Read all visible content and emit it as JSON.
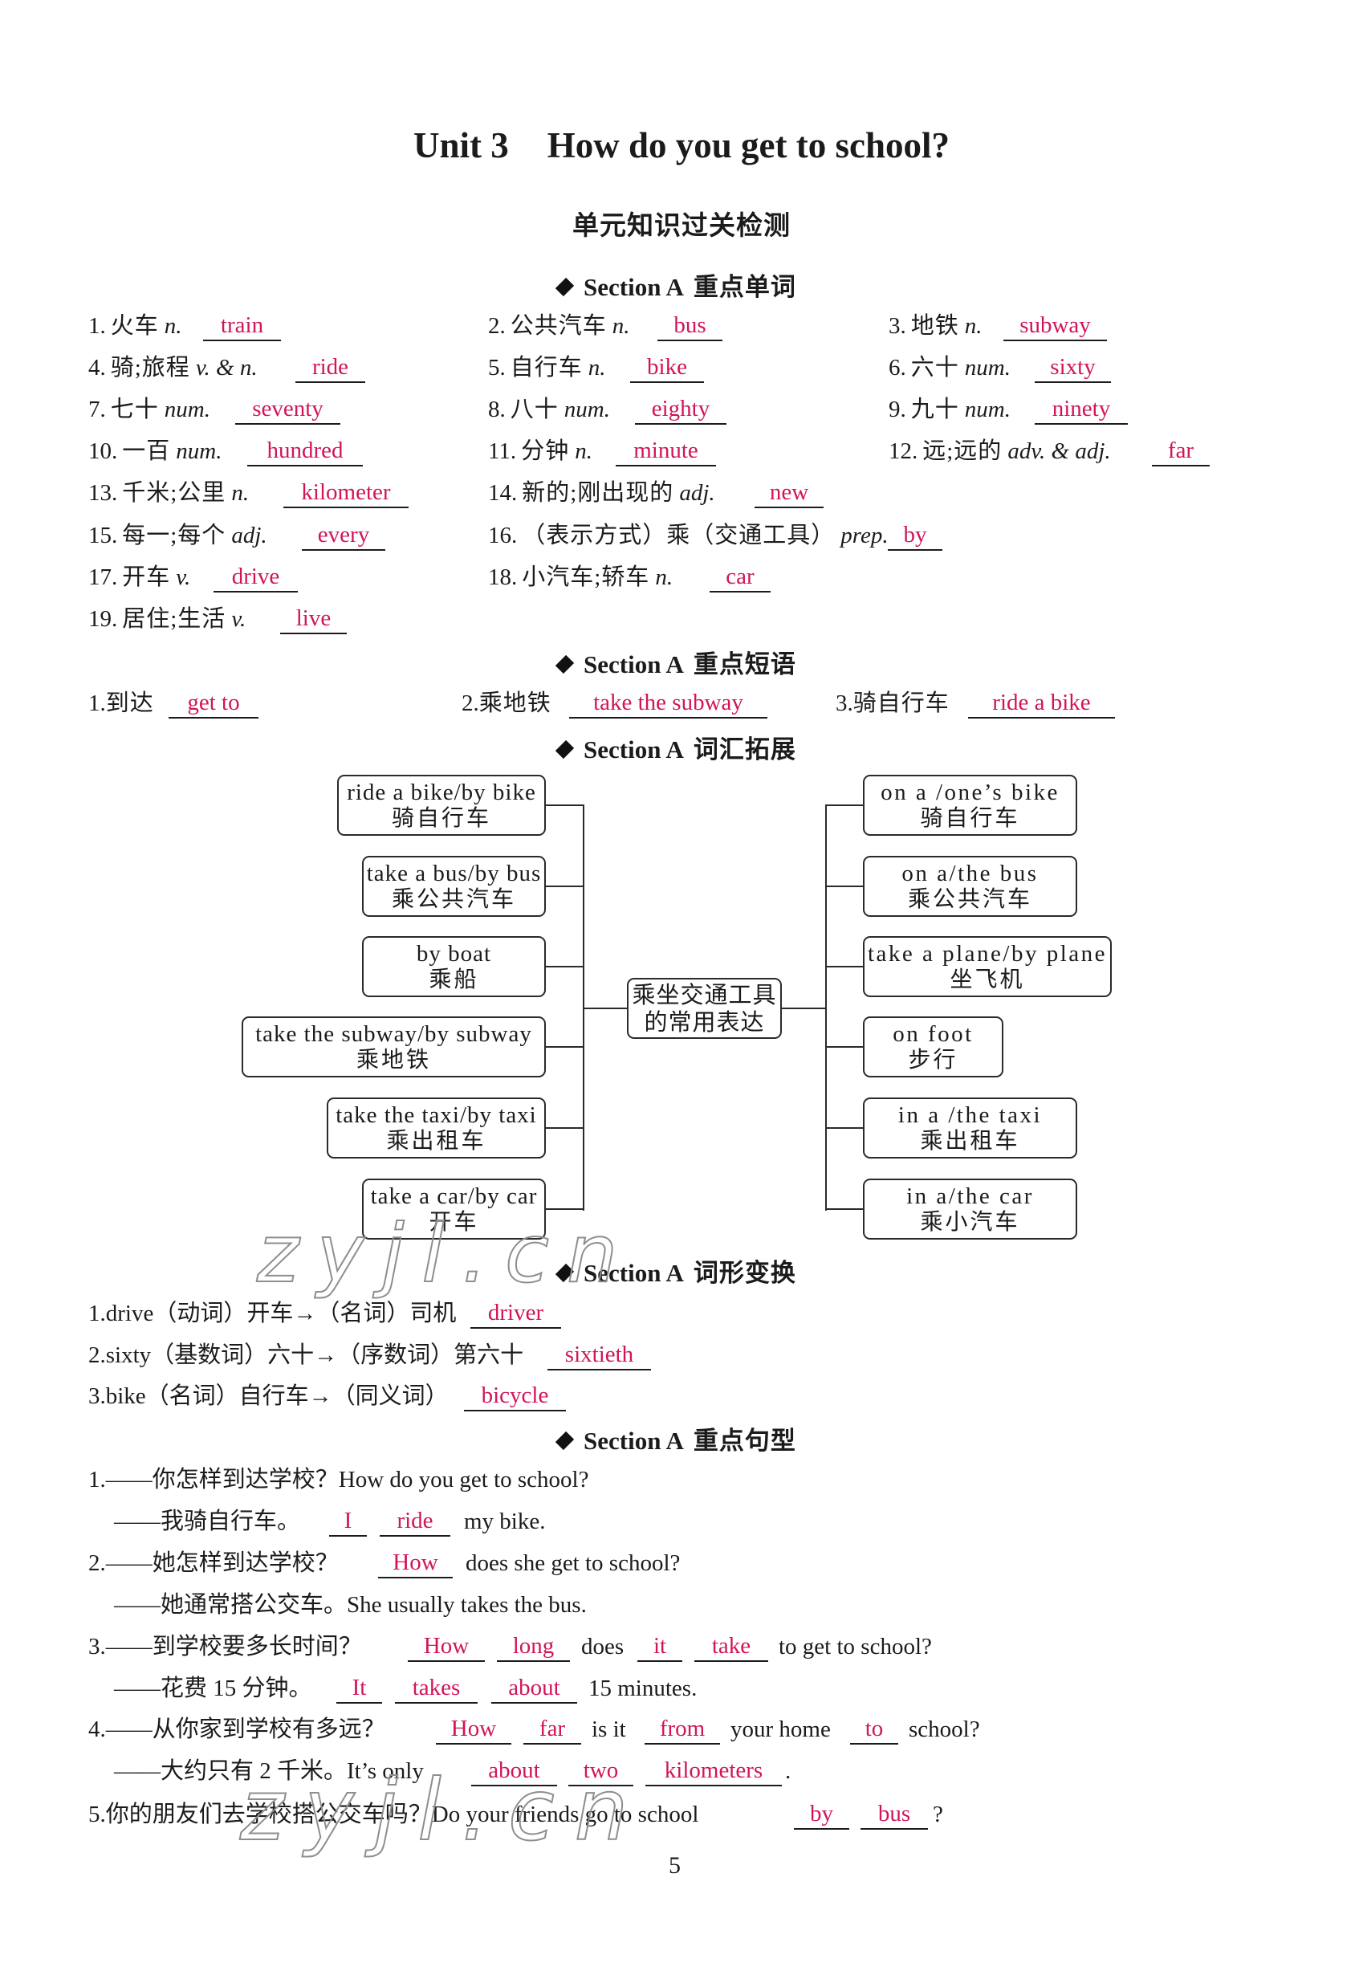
{
  "title": {
    "unit": "Unit 3",
    "text": "How do you get to school?"
  },
  "subtitle": "单元知识过关检测",
  "colors": {
    "answer": "#d2145a",
    "text": "#1b1b1b",
    "watermark_outline": "#8e8e8e"
  },
  "sections": {
    "vocabulary": {
      "icon": "diamond-bullet",
      "en": "Section A",
      "cn": "重点单词"
    },
    "phrases": {
      "icon": "diamond-bullet",
      "en": "Section A",
      "cn": "重点短语"
    },
    "expansion": {
      "icon": "diamond-bullet",
      "en": "Section A",
      "cn": "词汇拓展"
    },
    "word_forms": {
      "icon": "diamond-bullet",
      "en": "Section A",
      "cn": "词形变换"
    },
    "sentences": {
      "icon": "diamond-bullet",
      "en": "Section A",
      "cn": "重点句型"
    }
  },
  "vocabulary": [
    {
      "number": "1.",
      "chinese": "火车",
      "pos": "n.",
      "answer": "train"
    },
    {
      "number": "2.",
      "chinese": "公共汽车",
      "pos": "n.",
      "answer": "bus"
    },
    {
      "number": "3.",
      "chinese": "地铁",
      "pos": "n.",
      "answer": "subway"
    },
    {
      "number": "4.",
      "chinese": "骑;旅程",
      "pos": "v. & n.",
      "answer": "ride"
    },
    {
      "number": "5.",
      "chinese": "自行车",
      "pos": "n.",
      "answer": "bike"
    },
    {
      "number": "6.",
      "chinese": "六十",
      "pos": "num.",
      "answer": "sixty"
    },
    {
      "number": "7.",
      "chinese": "七十",
      "pos": "num.",
      "answer": "seventy"
    },
    {
      "number": "8.",
      "chinese": "八十",
      "pos": "num.",
      "answer": "eighty"
    },
    {
      "number": "9.",
      "chinese": "九十",
      "pos": "num.",
      "answer": "ninety"
    },
    {
      "number": "10.",
      "chinese": "一百",
      "pos": "num.",
      "answer": "hundred"
    },
    {
      "number": "11.",
      "chinese": "分钟",
      "pos": "n.",
      "answer": "minute"
    },
    {
      "number": "12.",
      "chinese": "远;远的",
      "pos": "adv. & adj.",
      "answer": "far"
    },
    {
      "number": "13.",
      "chinese": "千米;公里",
      "pos": "n.",
      "answer": "kilometer"
    },
    {
      "number": "14.",
      "chinese": "新的;刚出现的",
      "pos": "adj.",
      "answer": "new"
    },
    {
      "number": "15.",
      "chinese": "每一;每个",
      "pos": "adj.",
      "answer": "every"
    },
    {
      "number": "16.",
      "chinese": "（表示方式）乘（交通工具）",
      "pos": "prep.",
      "answer": "by"
    },
    {
      "number": "17.",
      "chinese": "开车",
      "pos": "v.",
      "answer": "drive"
    },
    {
      "number": "18.",
      "chinese": "小汽车;轿车",
      "pos": "n.",
      "answer": "car"
    },
    {
      "number": "19.",
      "chinese": "居住;生活",
      "pos": "v.",
      "answer": "live"
    }
  ],
  "phrases": [
    {
      "number": "1.",
      "chinese": "到达",
      "answer": "get to"
    },
    {
      "number": "2.",
      "chinese": "乘地铁",
      "answer": "take the subway"
    },
    {
      "number": "3.",
      "chinese": "骑自行车",
      "answer": "ride a bike"
    }
  ],
  "diagram": {
    "center_lines": [
      "乘坐交通工具",
      "的常用表达"
    ],
    "left": [
      {
        "en": "ride a bike/by bike",
        "cn": "骑自行车"
      },
      {
        "en": "take a bus/by bus",
        "cn": "乘公共汽车"
      },
      {
        "en": "by boat",
        "cn": "乘船"
      },
      {
        "en": "take the subway/by subway",
        "cn": "乘地铁"
      },
      {
        "en": "take the taxi/by taxi",
        "cn": "乘出租车"
      },
      {
        "en": "take a car/by car",
        "cn": "开车"
      }
    ],
    "right": [
      {
        "en": "on a /one’s bike",
        "cn": "骑自行车"
      },
      {
        "en": "on a/the bus",
        "cn": "乘公共汽车"
      },
      {
        "en": "take a plane/by plane",
        "cn": "坐飞机"
      },
      {
        "en": "on foot",
        "cn": "步行"
      },
      {
        "en": "in a /the taxi",
        "cn": "乘出租车"
      },
      {
        "en": "in a/the car",
        "cn": "乘小汽车"
      }
    ]
  },
  "word_forms": [
    {
      "number": "1.",
      "prompt": "drive（动词）开车→（名词）司机",
      "answer": "driver"
    },
    {
      "number": "2.",
      "prompt": "sixty（基数词）六十→（序数词）第六十",
      "answer": "sixtieth"
    },
    {
      "number": "3.",
      "prompt": "bike（名词）自行车→（同义词）",
      "answer": "bicycle"
    }
  ],
  "sentences": [
    {
      "number": "1.",
      "parts": [
        {
          "text": "——你怎样到达学校？How do you get to school?"
        }
      ]
    },
    {
      "parts": [
        {
          "text": "——我骑自行车。"
        },
        {
          "answer": "I"
        },
        {
          "answer": "ride"
        },
        {
          "text": "my bike."
        }
      ]
    },
    {
      "number": "2.",
      "parts": [
        {
          "text": "——她怎样到达学校？"
        },
        {
          "answer": "How"
        },
        {
          "text": "does she get to school?"
        }
      ]
    },
    {
      "parts": [
        {
          "text": "——她通常搭公交车。She usually takes the bus."
        }
      ]
    },
    {
      "number": "3.",
      "parts": [
        {
          "text": "——到学校要多长时间？"
        },
        {
          "answer": "How"
        },
        {
          "answer": "long"
        },
        {
          "text": "does"
        },
        {
          "answer": "it"
        },
        {
          "answer": "take"
        },
        {
          "text": "to get to school?"
        }
      ]
    },
    {
      "parts": [
        {
          "text": "——花费 15 分钟。"
        },
        {
          "answer": "It"
        },
        {
          "answer": "takes"
        },
        {
          "answer": "about"
        },
        {
          "text": "15 minutes."
        }
      ]
    },
    {
      "number": "4.",
      "parts": [
        {
          "text": "——从你家到学校有多远？"
        },
        {
          "answer": "How"
        },
        {
          "answer": "far"
        },
        {
          "text": "is it"
        },
        {
          "answer": "from"
        },
        {
          "text": "your home"
        },
        {
          "answer": "to"
        },
        {
          "text": "school?"
        }
      ]
    },
    {
      "parts": [
        {
          "text": "——大约只有 2 千米。It’s only"
        },
        {
          "answer": "about"
        },
        {
          "answer": "two"
        },
        {
          "answer": "kilometers"
        },
        {
          "text": "."
        }
      ]
    },
    {
      "number": "5.",
      "parts": [
        {
          "text": "你的朋友们去学校搭公交车吗？Do your friends go to school"
        },
        {
          "answer": "by"
        },
        {
          "answer": "bus"
        },
        {
          "text": "?"
        }
      ]
    }
  ],
  "page_number": "5",
  "watermark": "zyjl.cn"
}
